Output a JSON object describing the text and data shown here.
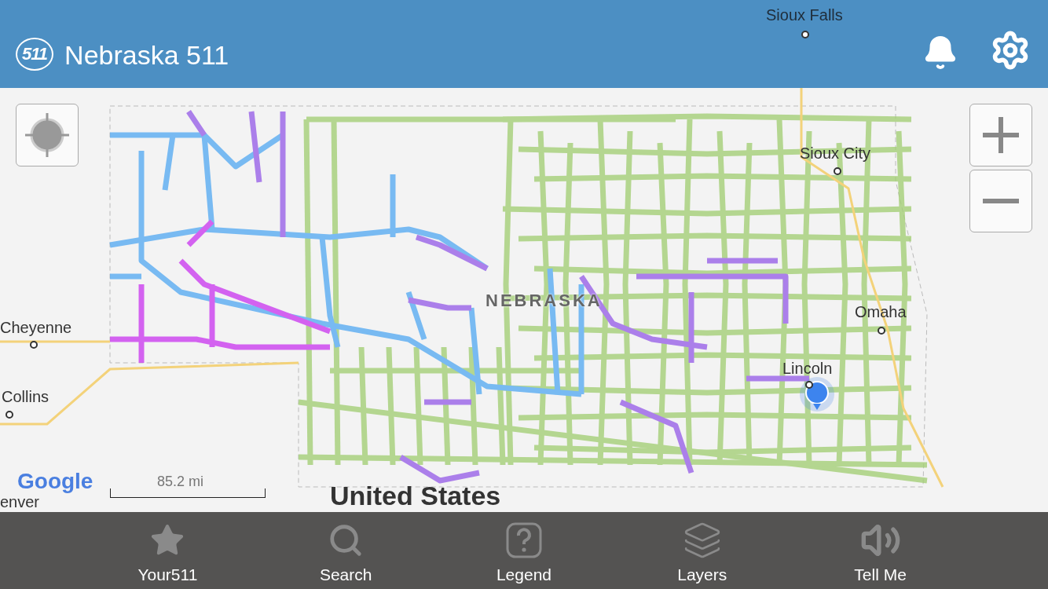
{
  "header": {
    "title": "Nebraska 511",
    "logo": "511"
  },
  "map": {
    "labels": [
      {
        "text": "Sioux Falls",
        "kind": "city"
      },
      {
        "text": "Sioux City",
        "kind": "city"
      },
      {
        "text": "NEBRASKA",
        "kind": "state"
      },
      {
        "text": "Omaha",
        "kind": "city"
      },
      {
        "text": "Cheyenne",
        "kind": "city"
      },
      {
        "text": "Lincoln",
        "kind": "city"
      },
      {
        "text": "Collins",
        "kind": "city"
      },
      {
        "text": "enver",
        "kind": "plain"
      },
      {
        "text": "United States",
        "kind": "country"
      }
    ],
    "google": "Google",
    "scale": "85.2 mi"
  },
  "tabs": [
    {
      "label": "Your511"
    },
    {
      "label": "Search"
    },
    {
      "label": "Legend"
    },
    {
      "label": "Layers"
    },
    {
      "label": "Tell Me"
    }
  ]
}
